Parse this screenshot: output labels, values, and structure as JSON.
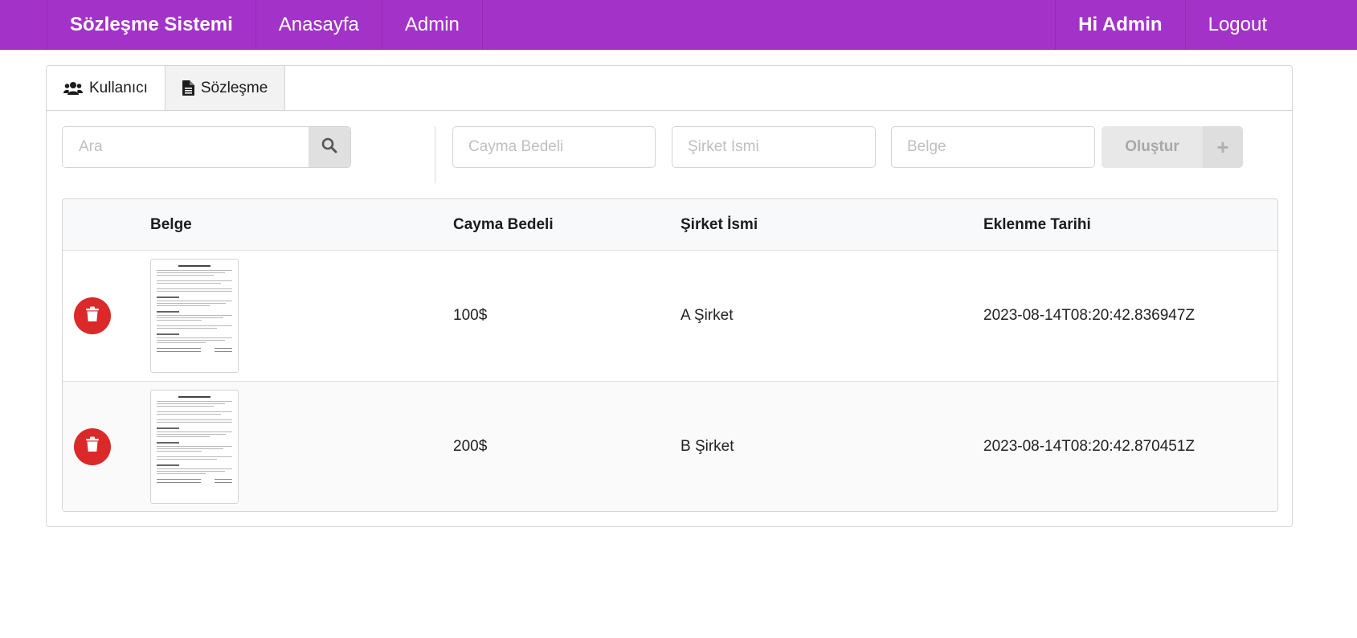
{
  "nav": {
    "brand": "Sözleşme Sistemi",
    "links": [
      "Anasayfa",
      "Admin"
    ],
    "greeting": "Hi Admin",
    "logout": "Logout"
  },
  "tabs": [
    {
      "label": "Kullanıcı",
      "icon": "users-icon",
      "active": false
    },
    {
      "label": "Sözleşme",
      "icon": "file-icon",
      "active": true
    }
  ],
  "toolbar": {
    "search_placeholder": "Ara",
    "search_value": "",
    "fields": [
      {
        "placeholder": "Cayma Bedeli",
        "value": ""
      },
      {
        "placeholder": "Şirket İsmi",
        "value": ""
      },
      {
        "placeholder": "Belge",
        "value": ""
      }
    ],
    "create_label": "Oluştur",
    "create_icon": "plus-icon"
  },
  "table": {
    "columns": [
      "",
      "Belge",
      "Cayma Bedeli",
      "Şirket İsmi",
      "Eklenme Tarihi"
    ],
    "rows": [
      {
        "cayma_bedeli": "100$",
        "sirket": "A Şirket",
        "tarih": "2023-08-14T08:20:42.836947Z"
      },
      {
        "cayma_bedeli": "200$",
        "sirket": "B Şirket",
        "tarih": "2023-08-14T08:20:42.870451Z"
      }
    ]
  },
  "colors": {
    "nav_bg": "#a333c8",
    "delete_red": "#db2828"
  }
}
